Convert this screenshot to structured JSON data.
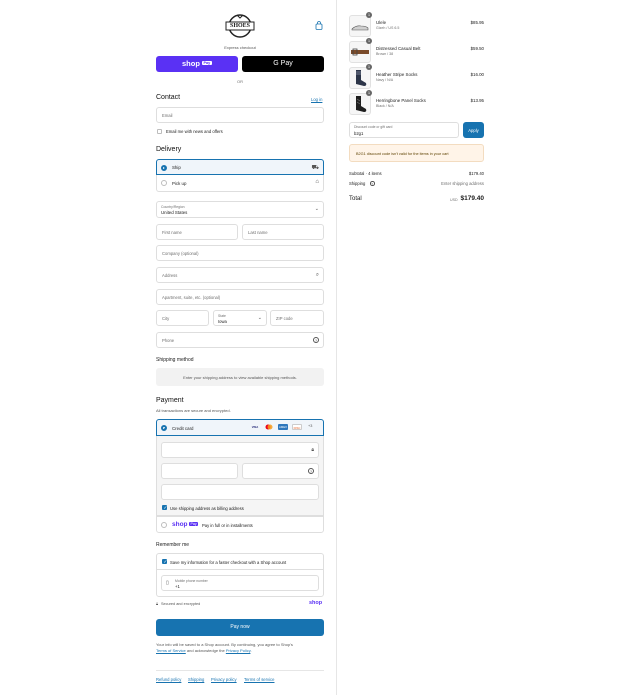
{
  "brand": {
    "logo_text": "SHOES",
    "cart_icon": "shopping-bag-icon"
  },
  "express": {
    "label": "Express checkout",
    "shop_pay": "shop",
    "shop_pay_badge": "Pay",
    "google_pay": "G Pay",
    "or": "OR"
  },
  "contact": {
    "title": "Contact",
    "login_link": "Log in",
    "email_placeholder": "Email",
    "news_label": "Email me with news and offers"
  },
  "delivery": {
    "title": "Delivery",
    "ship_label": "Ship",
    "pickup_label": "Pick up",
    "country_label": "Country/Region",
    "country_value": "United States",
    "first_name": "First name",
    "last_name": "Last name",
    "company": "Company (optional)",
    "address": "Address",
    "apartment": "Apartment, suite, etc. (optional)",
    "city": "City",
    "state_label": "State",
    "state_value": "Iowa",
    "zip": "ZIP code",
    "phone": "Phone"
  },
  "shipping_method": {
    "title": "Shipping method",
    "message": "Enter your shipping address to view available shipping methods."
  },
  "payment": {
    "title": "Payment",
    "subtitle": "All transactions are secure and encrypted.",
    "credit_card_label": "Credit card",
    "card_logos": [
      "VISA",
      "MC",
      "AMEX",
      "DISC"
    ],
    "more_cards": "+3",
    "billing_label": "Use shipping address as billing address",
    "shop_pay_label": "Pay in full or in installments",
    "shop_pay_logo": "shop",
    "shop_pay_badge": "Pay"
  },
  "remember": {
    "title": "Remember me",
    "save_label": "Save my information for a faster checkout with a Shop account",
    "phone_label": "Mobile phone number",
    "phone_value": "+1",
    "secure_label": "Secured and encrypted",
    "shop_logo": "shop"
  },
  "pay_now": "Pay now",
  "legal": {
    "line1": "Your info will be saved to a Shop account. By continuing, you agree to Shop's",
    "terms": "Terms of Service",
    "middle": " and acknowledge the ",
    "privacy": "Privacy Policy",
    "end": "."
  },
  "footer": [
    "Refund policy",
    "Shipping",
    "Privacy policy",
    "Terms of service"
  ],
  "cart": {
    "items": [
      {
        "qty": "1",
        "name": "Ulele",
        "variant": "Gizeh / US 6.5",
        "price": "$85.95"
      },
      {
        "qty": "1",
        "name": "Distressed Casual Belt",
        "variant": "Brown / 38",
        "price": "$59.50"
      },
      {
        "qty": "1",
        "name": "Heather Stripe Socks",
        "variant": "Navy / N/A",
        "price": "$16.00"
      },
      {
        "qty": "1",
        "name": "Herringbone Panel Socks",
        "variant": "Black / N/A",
        "price": "$13.95"
      }
    ],
    "discount_label": "Discount code or gift card",
    "discount_value": "b2g1",
    "apply": "Apply",
    "discount_error": "B2G1 discount code isn't valid for the items in your cart",
    "subtotal_label": "Subtotal · 4 items",
    "subtotal_value": "$179.40",
    "shipping_label": "Shipping",
    "shipping_value": "Enter shipping address",
    "total_label": "Total",
    "currency": "USD",
    "total_value": "$179.40"
  },
  "colors": {
    "accent": "#1773b0",
    "shop_purple": "#5a31f4",
    "error_bg": "#fff4e8"
  }
}
